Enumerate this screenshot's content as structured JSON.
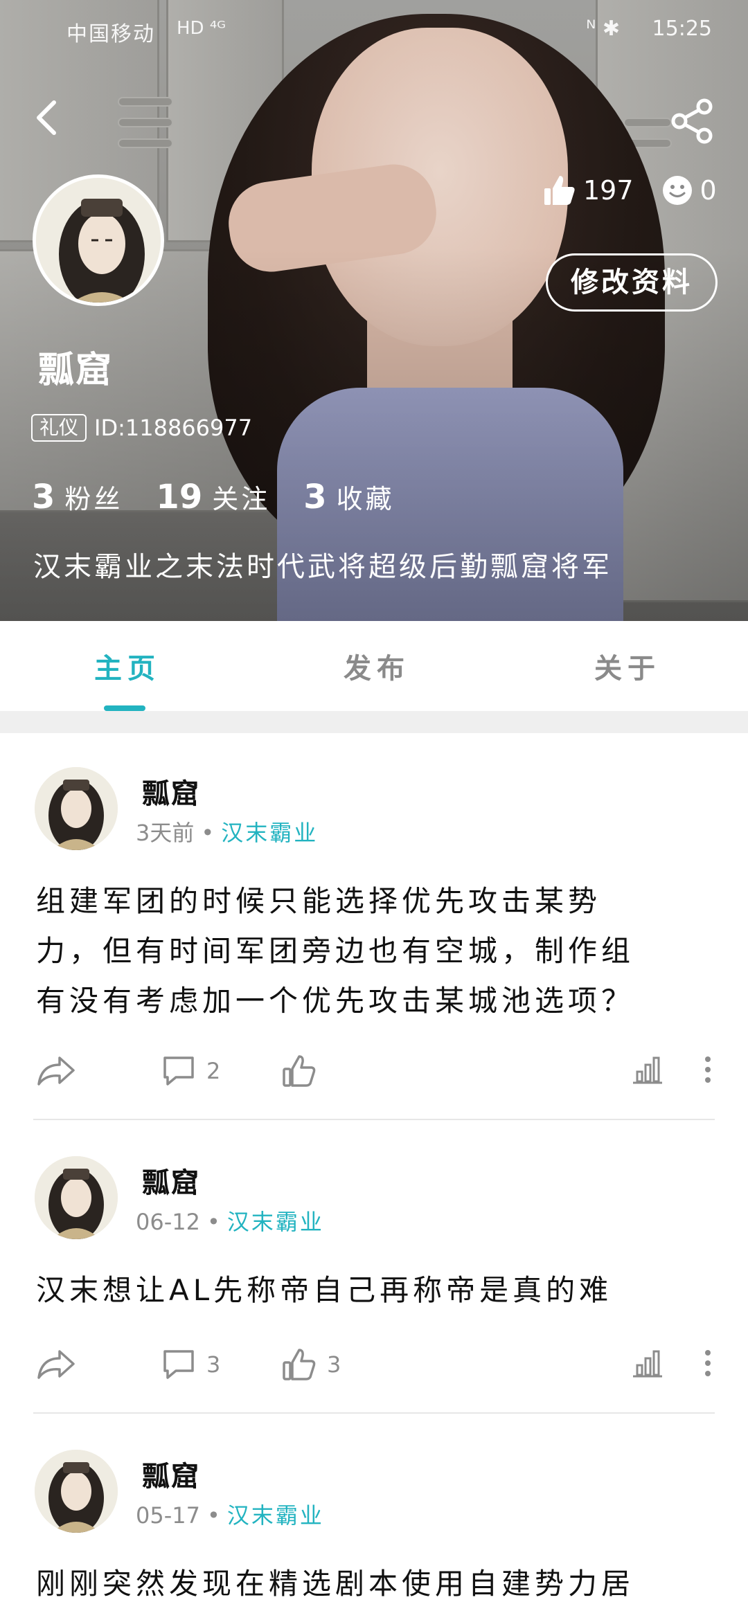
{
  "status_bar": {
    "carrier": "中国移动",
    "network_icons": "HD ⁴ᴳ",
    "right_icons": "ᴺ ✱",
    "time": "15:25"
  },
  "header": {
    "back_icon": "chevron-left-icon",
    "share_icon": "share-icon",
    "username": "瓢窟",
    "badge": "礼仪",
    "user_id": "ID:118866977",
    "likes_count": "197",
    "smiles_count": "0",
    "edit_label": "修改资料",
    "stats": [
      {
        "num": "3",
        "label": "粉丝"
      },
      {
        "num": "19",
        "label": "关注"
      },
      {
        "num": "3",
        "label": "收藏"
      }
    ],
    "bio": "汉末霸业之末法时代武将超级后勤瓢窟将军"
  },
  "tabs": [
    {
      "label": "主页",
      "active": true
    },
    {
      "label": "发布",
      "active": false
    },
    {
      "label": "关于",
      "active": false
    }
  ],
  "posts": [
    {
      "author": "瓢窟",
      "time": "3天前",
      "topic": "汉末霸业",
      "content_lines": [
        "组建军团的时候只能选择优先攻击某势",
        "力，但有时间军团旁边也有空城，制作组",
        "有没有考虑加一个优先攻击某城池选项？"
      ],
      "comments": "2",
      "likes": ""
    },
    {
      "author": "瓢窟",
      "time": "06-12",
      "topic": "汉末霸业",
      "content_lines": [
        "汉末想让AL先称帝自己再称帝是真的难"
      ],
      "comments": "3",
      "likes": "3"
    },
    {
      "author": "瓢窟",
      "time": "05-17",
      "topic": "汉末霸业",
      "content_lines": [
        "刚刚突然发现在精选剧本使用自建势力居"
      ],
      "comments": "",
      "likes": ""
    }
  ],
  "colors": {
    "accent": "#22b3c0",
    "text": "#111111",
    "muted": "#8c8c8c"
  }
}
